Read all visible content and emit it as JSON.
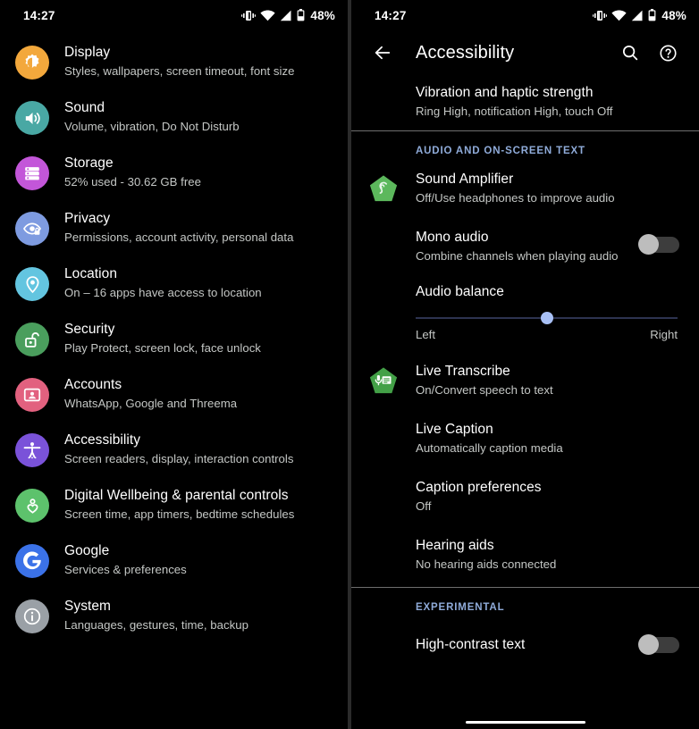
{
  "status_bar": {
    "time": "14:27",
    "battery_percent": "48%",
    "icons": [
      "vibrate-icon",
      "wifi-icon",
      "signal-icon",
      "battery-icon"
    ]
  },
  "left_panel": {
    "name": "settings-list",
    "items": [
      {
        "title": "Display",
        "subtitle": "Styles, wallpapers, screen timeout, font size",
        "icon": "brightness-icon",
        "color": "#F3A83C"
      },
      {
        "title": "Sound",
        "subtitle": "Volume, vibration, Do Not Disturb",
        "icon": "volume-icon",
        "color": "#49A8A4"
      },
      {
        "title": "Storage",
        "subtitle": "52% used - 30.62 GB free",
        "icon": "storage-icon",
        "color": "#C356D9"
      },
      {
        "title": "Privacy",
        "subtitle": "Permissions, account activity, personal data",
        "icon": "eye-lock-icon",
        "color": "#7E9BE0"
      },
      {
        "title": "Location",
        "subtitle": "On – 16 apps have access to location",
        "icon": "location-pin-icon",
        "color": "#63C5E0"
      },
      {
        "title": "Security",
        "subtitle": "Play Protect, screen lock, face unlock",
        "icon": "unlocked-padlock-icon",
        "color": "#4A9E5D"
      },
      {
        "title": "Accounts",
        "subtitle": "WhatsApp, Google and Threema",
        "icon": "account-card-icon",
        "color": "#E2617F"
      },
      {
        "title": "Accessibility",
        "subtitle": "Screen readers, display, interaction controls",
        "icon": "accessibility-person-icon",
        "color": "#7A52D9"
      },
      {
        "title": "Digital Wellbeing & parental controls",
        "subtitle": "Screen time, app timers, bedtime schedules",
        "icon": "heart-wellbeing-icon",
        "color": "#5DC26C"
      },
      {
        "title": "Google",
        "subtitle": "Services & preferences",
        "icon": "google-g-icon",
        "color": "#3B72E8"
      },
      {
        "title": "System",
        "subtitle": "Languages, gestures, time, backup",
        "icon": "info-icon",
        "color": "#9AA0A6"
      }
    ]
  },
  "right_panel": {
    "appbar": {
      "back_label": "back-arrow",
      "title": "Accessibility",
      "search_label": "search-icon",
      "help_label": "help-icon"
    },
    "top_item": {
      "title": "Vibration and haptic strength",
      "subtitle": "Ring High, notification High, touch Off"
    },
    "sections": [
      {
        "header": "AUDIO AND ON-SCREEN TEXT",
        "items": [
          {
            "type": "icon-row",
            "title": "Sound Amplifier",
            "subtitle": "Off/Use headphones to improve audio",
            "icon": "sound-amplifier-icon",
            "color": "#5CB85C"
          },
          {
            "type": "toggle-row",
            "title": "Mono audio",
            "subtitle": "Combine channels when playing audio",
            "toggle_state": "off"
          },
          {
            "type": "slider-row",
            "title": "Audio balance",
            "left_label": "Left",
            "right_label": "Right",
            "value_percent": 50
          },
          {
            "type": "icon-row",
            "title": "Live Transcribe",
            "subtitle": "On/Convert speech to text",
            "icon": "live-transcribe-icon",
            "color": "#4CAF50"
          },
          {
            "type": "plain-row",
            "title": "Live Caption",
            "subtitle": "Automatically caption media"
          },
          {
            "type": "plain-row",
            "title": "Caption preferences",
            "subtitle": "Off"
          },
          {
            "type": "plain-row",
            "title": "Hearing aids",
            "subtitle": "No hearing aids connected"
          }
        ]
      },
      {
        "header": "EXPERIMENTAL",
        "items": [
          {
            "type": "toggle-row",
            "title": "High-contrast text",
            "subtitle": "",
            "toggle_state": "off"
          }
        ]
      }
    ]
  },
  "colors": {
    "background": "#000000",
    "text_primary": "#ffffff",
    "text_secondary": "#c4c7c5",
    "section_header": "#8fabd9",
    "divider": "#6e6e6e",
    "slider_thumb": "#a8c0f5",
    "slider_track": "#2d3350",
    "toggle_thumb": "#bdbdbd",
    "toggle_track": "#3d3d3d"
  }
}
